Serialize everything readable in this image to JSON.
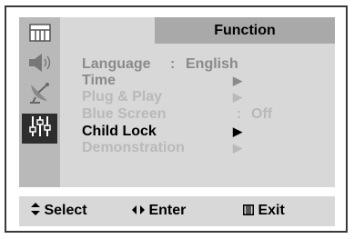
{
  "header": {
    "title": "Function"
  },
  "sidebar": {
    "items": [
      {
        "icon": "picture-icon",
        "active": false
      },
      {
        "icon": "speaker-icon",
        "active": false
      },
      {
        "icon": "satellite-dish-icon",
        "active": false
      },
      {
        "icon": "sliders-icon",
        "active": true
      }
    ]
  },
  "menu": {
    "items": [
      {
        "label": "Language",
        "separator": ":",
        "value": "English",
        "state": "normal"
      },
      {
        "label": "Time",
        "arrow": "▶",
        "state": "normal"
      },
      {
        "label": "Plug & Play",
        "arrow": "▶",
        "state": "disabled"
      },
      {
        "label": "Blue Screen",
        "separator": ":",
        "value": "Off",
        "state": "disabled"
      },
      {
        "label": "Child Lock",
        "arrow": "▶",
        "state": "selected"
      },
      {
        "label": "Demonstration",
        "arrow": "▶",
        "state": "disabled"
      }
    ]
  },
  "footer": {
    "select": {
      "icon": "up-down-arrows-icon",
      "label": "Select"
    },
    "enter": {
      "icon": "left-right-arrows-icon",
      "label": "Enter"
    },
    "exit": {
      "icon": "menu-icon",
      "label": "Exit"
    }
  },
  "colors": {
    "panel": "#d8d8d8",
    "sidebar": "#b9b9b9",
    "header": "#a9a9a9",
    "active_icon_bg": "#2e2e2e",
    "selected_text": "#000000",
    "normal_text": "#8a8a8a",
    "disabled_text": "#b9b9b9"
  }
}
